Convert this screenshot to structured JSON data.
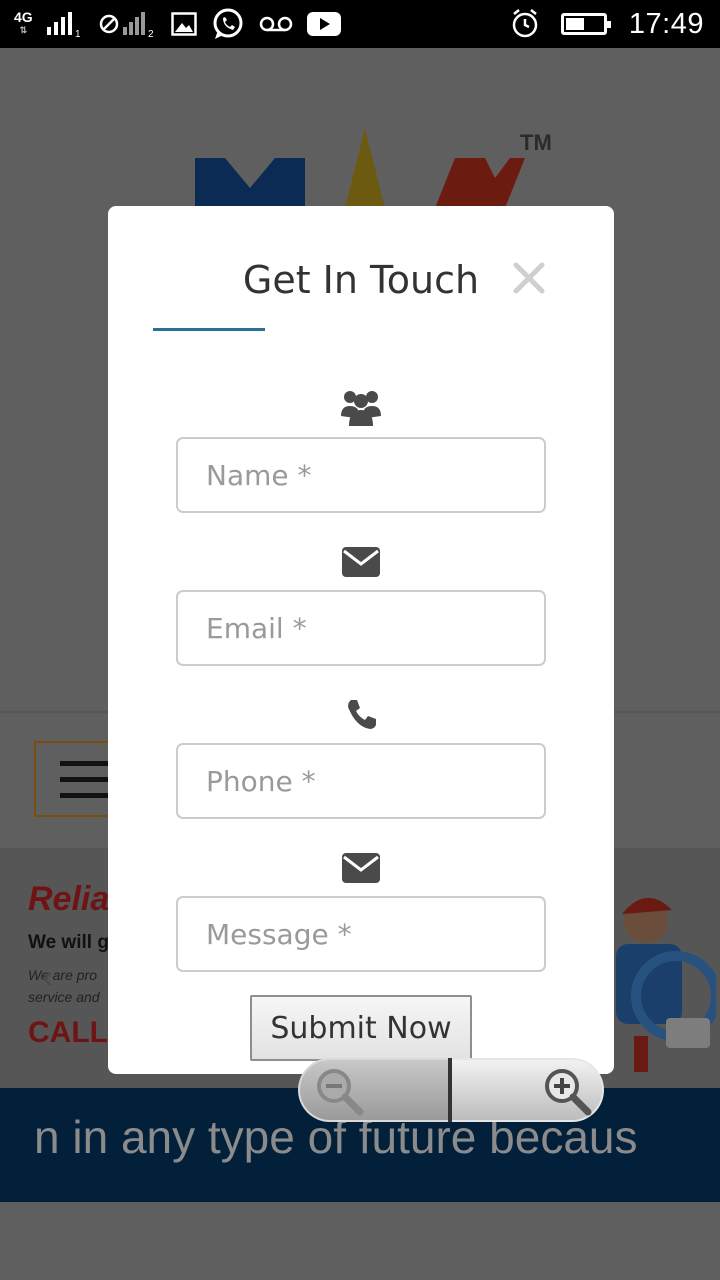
{
  "status_bar": {
    "network_label": "4G",
    "sim1": "1",
    "sim2": "2",
    "time": "17:49"
  },
  "background": {
    "logo_tm": "TM",
    "banner_title": "Relia",
    "banner_line1": "We will g",
    "banner_line2": "We are pro",
    "banner_line3": "service and",
    "banner_cta": "CALL U",
    "ticker": "n in any type of future becaus"
  },
  "modal": {
    "title": "Get In Touch",
    "fields": {
      "name_placeholder": "Name *",
      "email_placeholder": "Email *",
      "phone_placeholder": "Phone *",
      "message_placeholder": "Message *"
    },
    "submit_label": "Submit Now"
  },
  "colors": {
    "accent": "#2d6f95",
    "overlay": "#5f5f5f",
    "ticker_bg": "#03203b"
  },
  "icons": [
    "group-icon",
    "envelope-icon",
    "phone-icon",
    "envelope-icon",
    "close-icon",
    "zoom-out-icon",
    "zoom-in-icon"
  ]
}
